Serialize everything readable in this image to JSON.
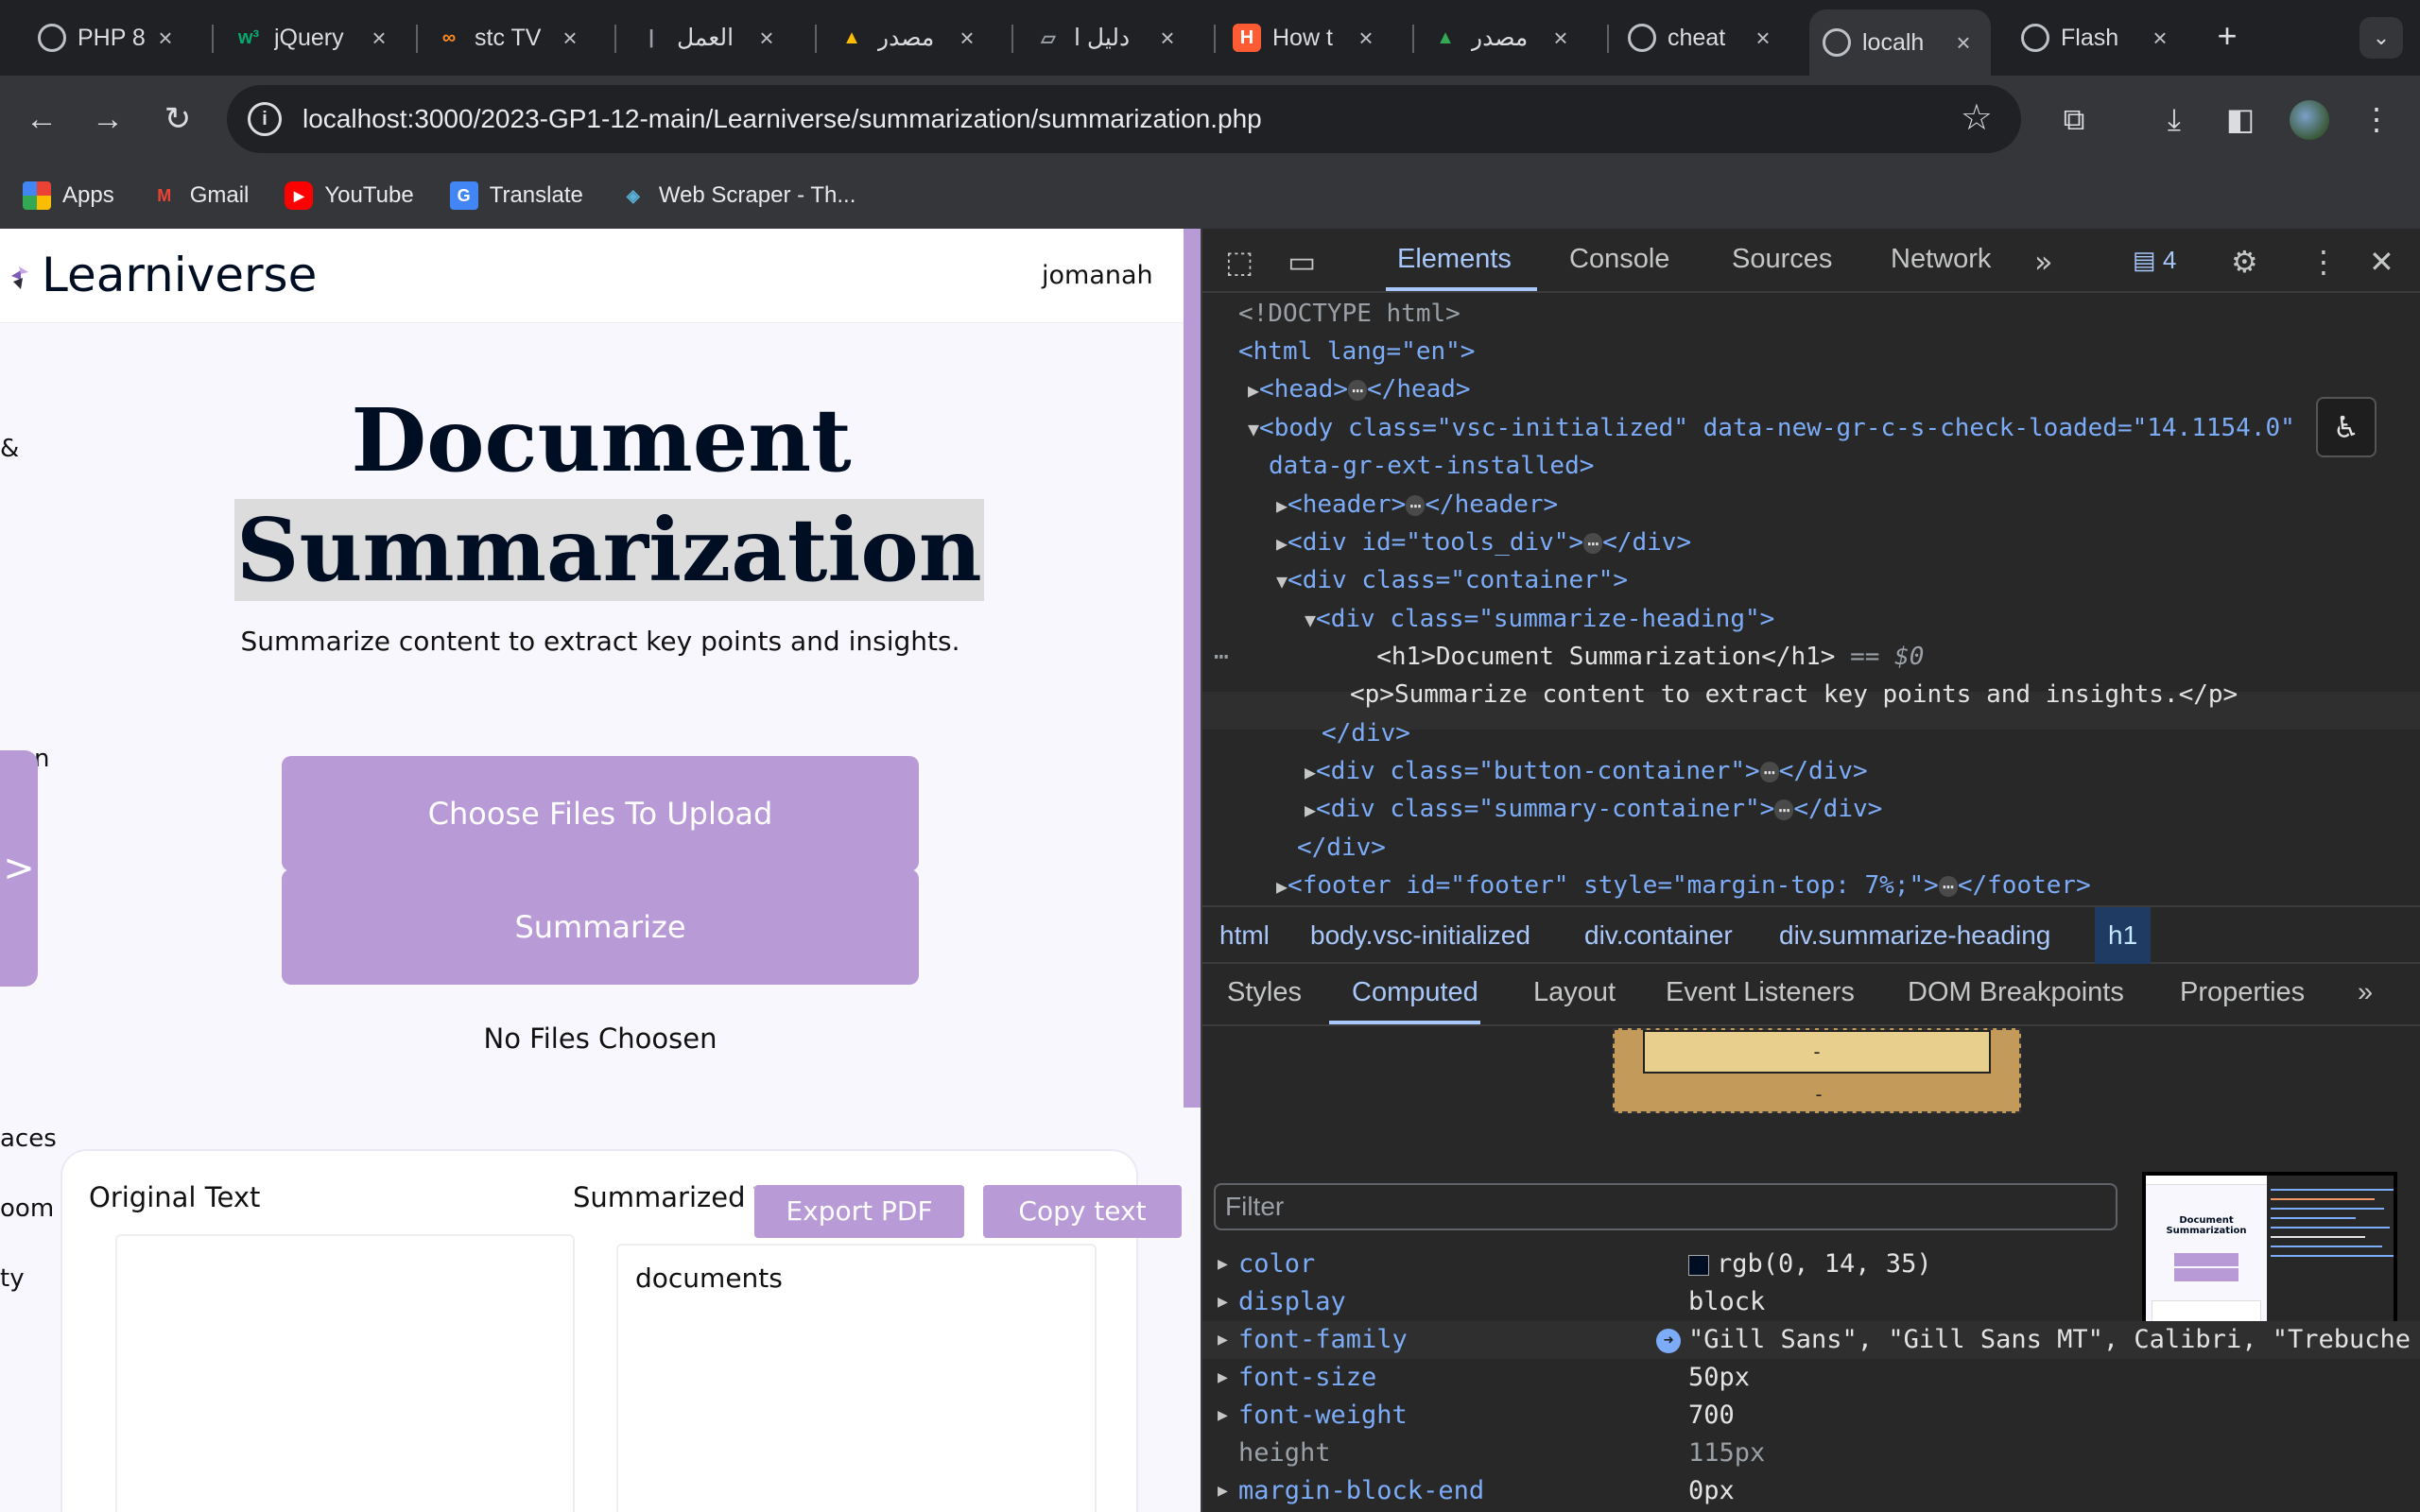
{
  "browser": {
    "tabs": [
      {
        "label": "PHP 8",
        "icon": "globe-icon"
      },
      {
        "label": "jQuery",
        "icon": "w3schools-icon"
      },
      {
        "label": "stc TV",
        "icon": "stc-icon"
      },
      {
        "label": "العمل",
        "icon": "candle-icon"
      },
      {
        "label": "مصدر",
        "icon": "drive-icon"
      },
      {
        "label": "دليل ا",
        "icon": "document-icon"
      },
      {
        "label": "How t",
        "icon": "hubspot-icon"
      },
      {
        "label": "مصدر",
        "icon": "drive-icon"
      },
      {
        "label": "cheat",
        "icon": "globe-icon"
      },
      {
        "label": "localh",
        "icon": "globe-icon",
        "active": true
      },
      {
        "label": "Flash",
        "icon": "globe-icon"
      }
    ],
    "url": "localhost:3000/2023-GP1-12-main/Learniverse/summarization/summarization.php",
    "bookmarks": [
      {
        "label": "Apps",
        "icon": "apps-grid-icon"
      },
      {
        "label": "Gmail",
        "icon": "gmail-icon"
      },
      {
        "label": "YouTube",
        "icon": "youtube-icon"
      },
      {
        "label": "Translate",
        "icon": "translate-icon"
      },
      {
        "label": "Web Scraper - Th...",
        "icon": "web-scraper-icon"
      }
    ]
  },
  "page": {
    "logo": "Learniverse",
    "user": "jomanah",
    "title_line1": "Document",
    "title_line2": "Summarization",
    "subtitle": "Summarize content to extract key points and insights.",
    "choose_button": "Choose Files To Upload",
    "summarize_button": "Summarize",
    "no_files": "No Files Choosen",
    "original_label": "Original Text",
    "summarized_label": "Summarized Te",
    "export_button": "Export PDF",
    "copy_button": "Copy text",
    "summary_content": "documents",
    "sidebar_toggle": ">",
    "sidebar_fragments": [
      "&",
      "n",
      "aces",
      "oom",
      "ty"
    ],
    "accent": "#b89ad6",
    "title_color": "#000e23"
  },
  "devtools": {
    "tabs": [
      "Elements",
      "Console",
      "Sources",
      "Network"
    ],
    "issues_count": "4",
    "dom": [
      "<!DOCTYPE html>",
      "<html lang=\"en\">",
      "<head>",
      "<body class=\"vsc-initialized\" data-new-gr-c-s-check-loaded=\"14.1154.0\"",
      "data-gr-ext-installed>",
      "<header>",
      "<div id=\"tools_div\">",
      "<div class=\"container\">",
      "<div class=\"summarize-heading\">",
      "<h1>Document Summarization</h1>",
      "<p>Summarize content to extract key points and insights.</p>",
      "</div>",
      "<div class=\"button-container\">",
      "<div class=\"summary-container\">",
      "</div>",
      "<footer id=\"footer\" style=\"margin-top: 7%;\">"
    ],
    "selected_marker": "== $0",
    "breadcrumbs": [
      "html",
      "body.vsc-initialized",
      "div.container",
      "div.summarize-heading",
      "h1"
    ],
    "subtabs": [
      "Styles",
      "Computed",
      "Layout",
      "Event Listeners",
      "DOM Breakpoints",
      "Properties"
    ],
    "boxmodel_inner": "-",
    "boxmodel_outer": "-",
    "filter_placeholder": "Filter",
    "computed": [
      {
        "name": "color",
        "value": "rgb(0, 14, 35)"
      },
      {
        "name": "display",
        "value": "block"
      },
      {
        "name": "font-family",
        "value": "\"Gill Sans\", \"Gill Sans MT\", Calibri, \"Trebuche"
      },
      {
        "name": "font-size",
        "value": "50px"
      },
      {
        "name": "font-weight",
        "value": "700"
      },
      {
        "name": "height",
        "value": "115px"
      },
      {
        "name": "margin-block-end",
        "value": "0px"
      }
    ]
  }
}
